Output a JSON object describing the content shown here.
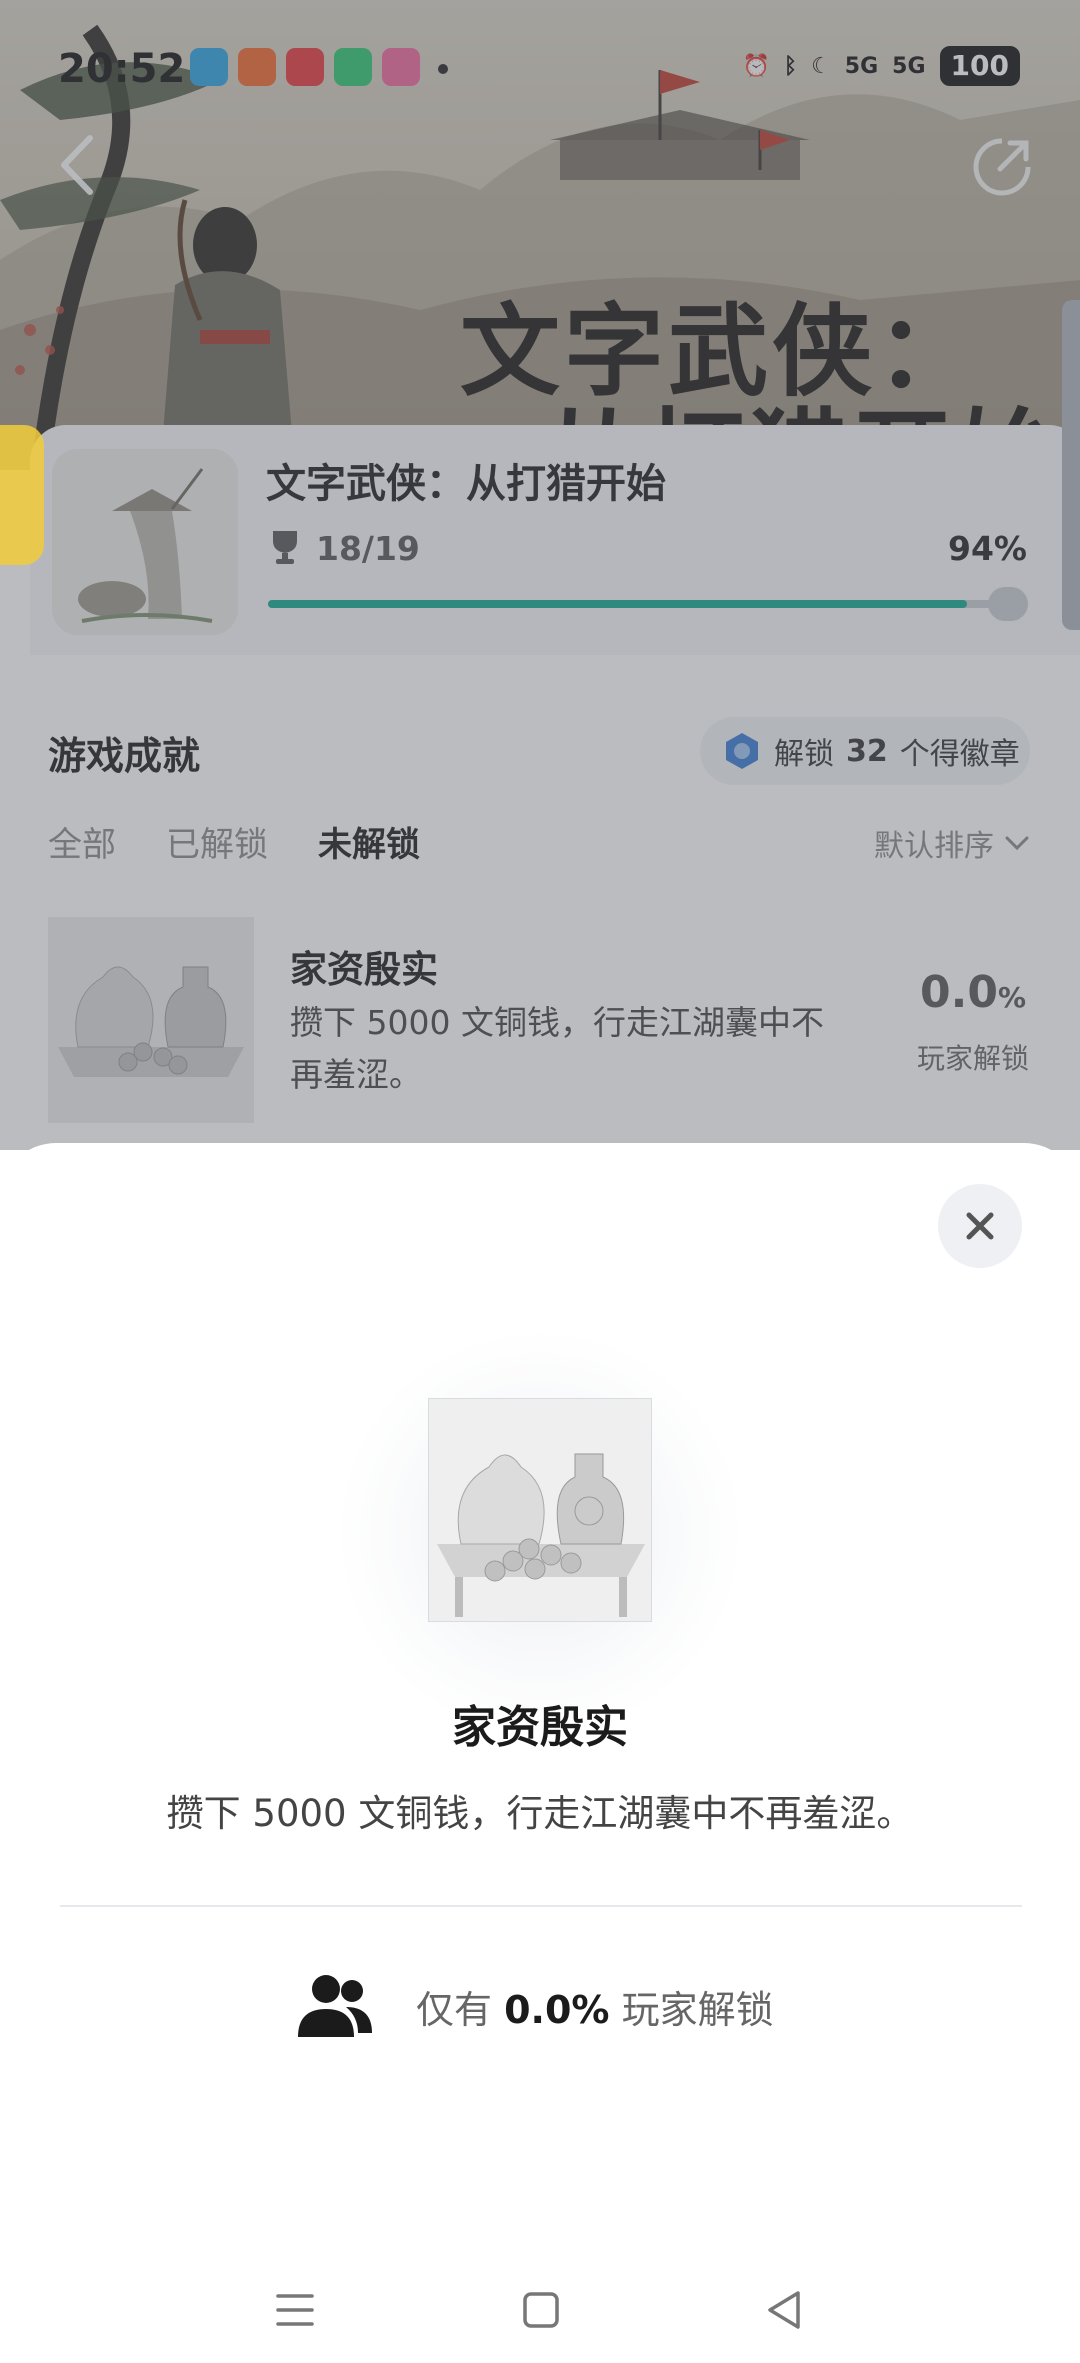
{
  "status_bar": {
    "time": "20:52",
    "battery": "100",
    "signal1": "5G",
    "signal2": "5G"
  },
  "game": {
    "title": "文字武侠：从打猎开始",
    "hero_title_line1": "文字武侠：",
    "hero_title_line2": "从打猎开始",
    "trophy_count": "18/19",
    "progress_pct_text": "94%",
    "progress_fraction": 0.94
  },
  "achievements": {
    "header": "游戏成就",
    "badge_pill": {
      "prefix": "解锁",
      "count": "32",
      "suffix": "个得徽章"
    },
    "tabs": [
      {
        "label": "全部",
        "active": false
      },
      {
        "label": "已解锁",
        "active": false
      },
      {
        "label": "未解锁",
        "active": true
      }
    ],
    "sort_label": "默认排序",
    "item": {
      "name": "家资殷实",
      "desc": "攒下 5000 文铜钱，行走江湖囊中不再羞涩。",
      "rate_value": "0.0",
      "rate_unit": "%",
      "rate_label": "玩家解锁"
    }
  },
  "sheet": {
    "title": "家资殷实",
    "desc": "攒下 5000 文铜钱，行走江湖囊中不再羞涩。",
    "unlock_prefix": "仅有",
    "unlock_value": "0.0%",
    "unlock_suffix": "玩家解锁"
  },
  "colors": {
    "accent": "#0fa88f",
    "overlay": "#5a5f69"
  },
  "icons": [
    "back-icon",
    "share-icon",
    "trophy-icon",
    "badge-icon",
    "chevron-down-icon",
    "close-icon",
    "people-icon",
    "menu-icon",
    "home-icon",
    "nav-back-icon"
  ]
}
